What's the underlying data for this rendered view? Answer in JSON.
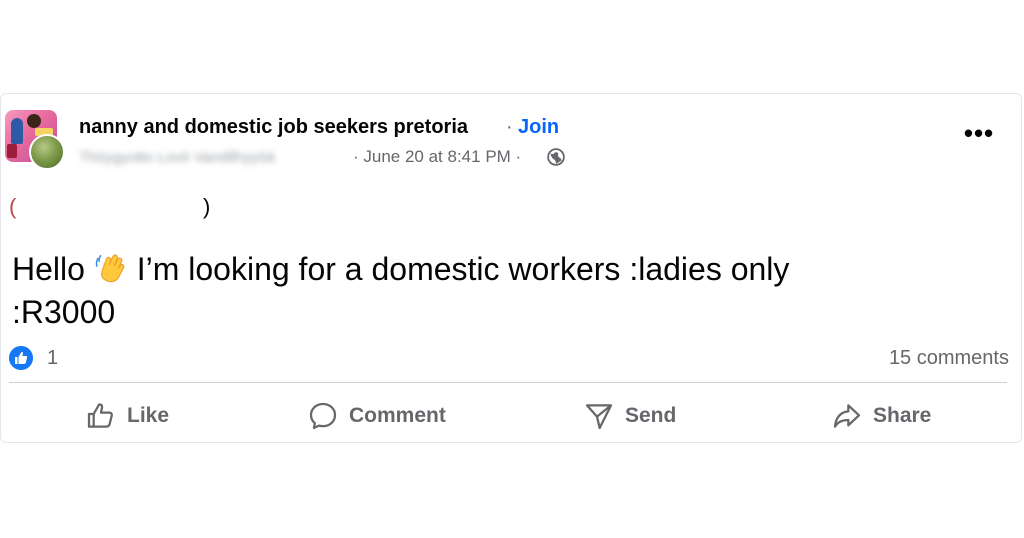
{
  "post": {
    "group_name": "nanny and domestic job seekers pretoria",
    "separator": "·",
    "join_label": "Join",
    "author_name": "Thöygyotto Lovö Vandilhyyöä",
    "meta": "· June 20 at 8:41 PM ·",
    "censored_open": "(",
    "censored_close": ")",
    "body_line1_before": "Hello ",
    "body_line1_after": " I’m looking for a domestic workers :ladies only",
    "body_line2": ":R3000",
    "more_label": "•••"
  },
  "stats": {
    "reactions": "1",
    "comments": "15 comments"
  },
  "actions": {
    "like": "Like",
    "comment": "Comment",
    "send": "Send",
    "share": "Share"
  },
  "icons": {
    "globe": "globe-icon",
    "like": "thumbs-up-icon",
    "comment": "speech-bubble-icon",
    "send": "paper-plane-icon",
    "share": "share-arrow-icon",
    "wave": "waving-hand-emoji",
    "like_badge": "like-reaction-icon"
  },
  "colors": {
    "link_blue": "#0866ff",
    "reaction_blue": "#1877f2",
    "secondary_text": "#65676b",
    "primary_text": "#050505"
  }
}
